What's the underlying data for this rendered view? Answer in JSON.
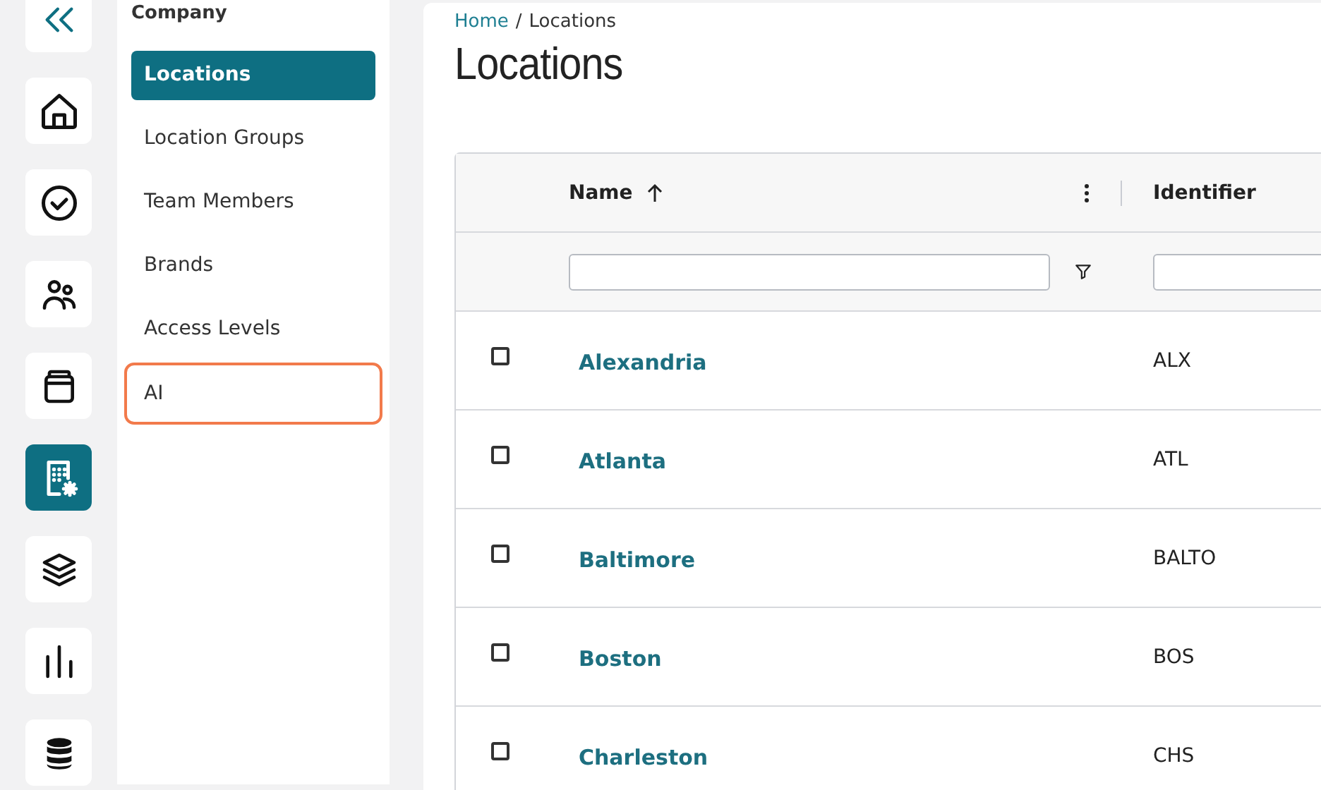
{
  "rail": [
    {
      "kind": "collapse",
      "selected": false
    },
    {
      "kind": "home",
      "selected": false
    },
    {
      "kind": "check",
      "selected": false
    },
    {
      "kind": "people",
      "selected": false
    },
    {
      "kind": "box",
      "selected": false
    },
    {
      "kind": "building",
      "selected": true
    },
    {
      "kind": "layers",
      "selected": false
    },
    {
      "kind": "bars",
      "selected": false
    },
    {
      "kind": "database",
      "selected": false
    }
  ],
  "subnav": {
    "heading": "Company",
    "items": [
      {
        "label": "Locations",
        "selected": true,
        "highlighted": false
      },
      {
        "label": "Location Groups",
        "selected": false,
        "highlighted": false
      },
      {
        "label": "Team Members",
        "selected": false,
        "highlighted": false
      },
      {
        "label": "Brands",
        "selected": false,
        "highlighted": false
      },
      {
        "label": "Access Levels",
        "selected": false,
        "highlighted": false
      },
      {
        "label": "AI",
        "selected": false,
        "highlighted": true
      }
    ]
  },
  "breadcrumb": [
    "Home",
    "/",
    "Locations"
  ],
  "title": "Locations",
  "table": {
    "columns": [
      {
        "label": "Name",
        "sorted": true
      },
      {
        "label": "Identifier",
        "sorted": false
      }
    ],
    "rows": [
      {
        "checked": false,
        "cells": [
          "Alexandria",
          "ALX"
        ]
      },
      {
        "checked": false,
        "cells": [
          "Atlanta",
          "ATL"
        ]
      },
      {
        "checked": false,
        "cells": [
          "Baltimore",
          "BALTO"
        ]
      },
      {
        "checked": false,
        "cells": [
          "Boston",
          "BOS"
        ]
      },
      {
        "checked": false,
        "cells": [
          "Charleston",
          "CHS"
        ]
      }
    ]
  }
}
